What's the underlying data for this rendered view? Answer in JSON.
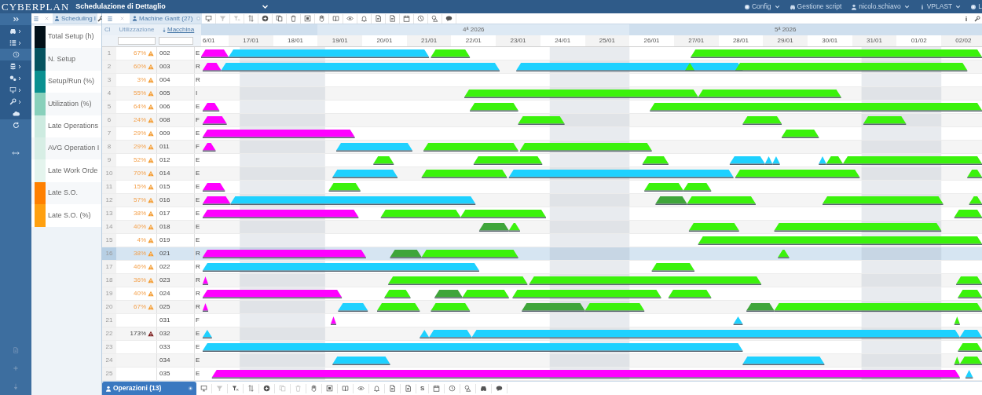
{
  "app": {
    "logo": "CYBERPLAN",
    "title": "Schedulazione di Dettaglio"
  },
  "top_menu": [
    {
      "label": "Config",
      "dropdown": true
    },
    {
      "label": "Gestione script",
      "dropdown": false
    },
    {
      "label": "nicolo.schiavo",
      "dropdown": true
    },
    {
      "label": "VPLAST",
      "dropdown": true
    },
    {
      "label": "L",
      "dropdown": false
    }
  ],
  "legend_panel": {
    "tab": "Scheduling I",
    "items": [
      {
        "label": "Total Setup (h)",
        "color": "#021018"
      },
      {
        "label": "N. Setup",
        "color": "#05525f"
      },
      {
        "label": "Setup/Run (%)",
        "color": "#0a9090"
      },
      {
        "label": "Utilization (%)",
        "color": "#88d0bb"
      },
      {
        "label": "Late Operations",
        "color": "#cdebe0"
      },
      {
        "label": "AVG Operation I",
        "color": "#d7eee5"
      },
      {
        "label": "Late Work Orde",
        "color": "#e4f4ed"
      },
      {
        "label": "Late S.O.",
        "color": "#ff8000"
      },
      {
        "label": "Late S.O. (%)",
        "color": "#ffa010"
      }
    ]
  },
  "gantt_panel": {
    "tab": "Machine Gantt (27)",
    "toolbar": [
      {
        "disabled": false
      },
      {
        "disabled": true
      },
      {
        "disabled": true
      },
      {
        "disabled": false
      },
      {
        "disabled": false
      },
      {
        "disabled": false
      },
      {
        "disabled": false
      },
      {
        "disabled": false
      },
      {
        "disabled": false
      },
      {
        "disabled": false
      },
      {
        "disabled": false
      },
      {
        "disabled": false
      },
      {
        "disabled": false
      },
      {
        "disabled": false
      },
      {
        "disabled": false
      },
      {
        "disabled": false
      },
      {
        "disabled": false
      },
      {
        "disabled": false
      }
    ],
    "columns": [
      "Cl",
      "Utilizzazione",
      "Macchina"
    ],
    "weeks": [
      "4ª 2026",
      "5ª 2026"
    ],
    "days": [
      "6/01",
      "17/01",
      "18/01",
      "19/01",
      "20/01",
      "21/01",
      "22/01",
      "23/01",
      "24/01",
      "25/01",
      "26/01",
      "27/01",
      "28/01",
      "29/01",
      "30/01",
      "31/01",
      "01/02",
      "02/02"
    ],
    "rows": [
      {
        "number": "1",
        "utilization": "67%",
        "warning": true,
        "critical": false,
        "machine": "002",
        "column_4": "E",
        "selected": false
      },
      {
        "number": "2",
        "utilization": "60%",
        "warning": true,
        "critical": false,
        "machine": "003",
        "column_4": "R",
        "selected": false
      },
      {
        "number": "3",
        "utilization": "3%",
        "warning": true,
        "critical": false,
        "machine": "004",
        "column_4": "R",
        "selected": false
      },
      {
        "number": "4",
        "utilization": "55%",
        "warning": true,
        "critical": false,
        "machine": "005",
        "column_4": "I",
        "selected": false
      },
      {
        "number": "5",
        "utilization": "64%",
        "warning": true,
        "critical": false,
        "machine": "006",
        "column_4": "E",
        "selected": false
      },
      {
        "number": "6",
        "utilization": "24%",
        "warning": true,
        "critical": false,
        "machine": "008",
        "column_4": "F",
        "selected": false
      },
      {
        "number": "7",
        "utilization": "29%",
        "warning": true,
        "critical": false,
        "machine": "009",
        "column_4": "E",
        "selected": false
      },
      {
        "number": "8",
        "utilization": "29%",
        "warning": true,
        "critical": false,
        "machine": "011",
        "column_4": "F",
        "selected": false
      },
      {
        "number": "9",
        "utilization": "52%",
        "warning": true,
        "critical": false,
        "machine": "012",
        "column_4": "E",
        "selected": false
      },
      {
        "number": "10",
        "utilization": "70%",
        "warning": true,
        "critical": false,
        "machine": "014",
        "column_4": "E",
        "selected": false
      },
      {
        "number": "11",
        "utilization": "15%",
        "warning": true,
        "critical": false,
        "machine": "015",
        "column_4": "E",
        "selected": false
      },
      {
        "number": "12",
        "utilization": "57%",
        "warning": true,
        "critical": false,
        "machine": "016",
        "column_4": "E",
        "selected": false
      },
      {
        "number": "13",
        "utilization": "38%",
        "warning": true,
        "critical": false,
        "machine": "017",
        "column_4": "E",
        "selected": false
      },
      {
        "number": "14",
        "utilization": "40%",
        "warning": true,
        "critical": false,
        "machine": "018",
        "column_4": "E",
        "selected": false
      },
      {
        "number": "15",
        "utilization": "4%",
        "warning": true,
        "critical": false,
        "machine": "019",
        "column_4": "E",
        "selected": false
      },
      {
        "number": "16",
        "utilization": "38%",
        "warning": true,
        "critical": false,
        "machine": "021",
        "column_4": "R",
        "selected": true
      },
      {
        "number": "17",
        "utilization": "46%",
        "warning": true,
        "critical": false,
        "machine": "022",
        "column_4": "R",
        "selected": false
      },
      {
        "number": "18",
        "utilization": "36%",
        "warning": true,
        "critical": false,
        "machine": "023",
        "column_4": "R",
        "selected": false
      },
      {
        "number": "19",
        "utilization": "40%",
        "warning": true,
        "critical": false,
        "machine": "024",
        "column_4": "R",
        "selected": false
      },
      {
        "number": "20",
        "utilization": "67%",
        "warning": true,
        "critical": false,
        "machine": "025",
        "column_4": "R",
        "selected": false
      },
      {
        "number": "21",
        "warning": false,
        "machine": "031",
        "column_4": "F",
        "selected": false
      },
      {
        "number": "22",
        "utilization": "173%",
        "warning": true,
        "critical": true,
        "machine": "032",
        "column_4": "E",
        "selected": false
      },
      {
        "number": "23",
        "warning": false,
        "machine": "033",
        "column_4": "E",
        "selected": false
      },
      {
        "number": "24",
        "warning": false,
        "machine": "034",
        "column_4": "E",
        "selected": false
      },
      {
        "number": "25",
        "warning": false,
        "machine": "035",
        "column_4": "E",
        "selected": false
      }
    ]
  },
  "bottom_panel": {
    "tab": "Operazioni (13)",
    "toolbar": [
      {
        "disabled": false
      },
      {
        "disabled": true
      },
      {
        "disabled": false
      },
      {
        "disabled": false
      },
      {
        "disabled": false
      },
      {
        "disabled": true
      },
      {
        "disabled": true
      },
      {
        "disabled": false
      },
      {
        "disabled": false
      },
      {
        "disabled": false
      },
      {
        "disabled": false
      },
      {
        "disabled": false
      },
      {
        "disabled": false
      },
      {
        "disabled": false
      },
      {
        "label": "S",
        "disabled": false
      },
      {
        "disabled": false
      },
      {
        "disabled": false
      },
      {
        "disabled": false
      },
      {
        "disabled": false
      },
      {
        "disabled": false
      }
    ]
  }
}
